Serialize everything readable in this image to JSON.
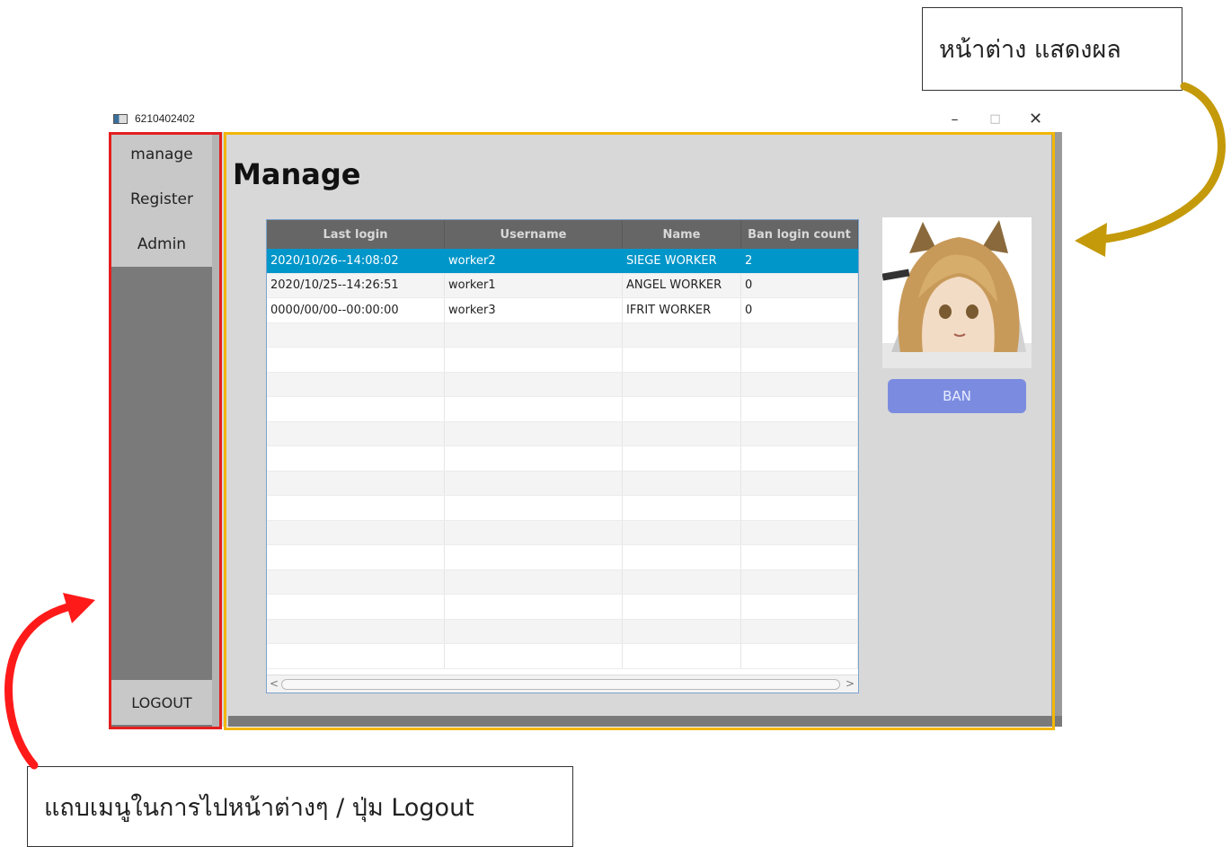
{
  "window": {
    "title": "6210402402",
    "minimize_glyph": "–",
    "maximize_glyph": "□",
    "close_glyph": "✕"
  },
  "sidebar": {
    "items": [
      {
        "label": "manage"
      },
      {
        "label": "Register"
      },
      {
        "label": "Admin"
      }
    ],
    "logout_label": "LOGOUT"
  },
  "main": {
    "title": "Manage",
    "table": {
      "columns": [
        "Last login",
        "Username",
        "Name",
        "Ban login count"
      ],
      "rows": [
        [
          "2020/10/26--14:08:02",
          "worker2",
          "SIEGE WORKER",
          "2"
        ],
        [
          "2020/10/25--14:26:51",
          "worker1",
          "ANGEL WORKER",
          "0"
        ],
        [
          "0000/00/00--00:00:00",
          "worker3",
          "IFRIT WORKER",
          "0"
        ]
      ],
      "selected_row": 0
    },
    "ban_label": "BAN"
  },
  "annotations": {
    "display_window": "หน้าต่าง แสดงผล",
    "menu_bar": "แถบเมนูในการไปหน้าต่างๆ / ปุ่ม Logout"
  },
  "colors": {
    "selection": "#0096c9",
    "ban_button": "#7b8ce0",
    "sidebar_highlight": "#e41f1f",
    "content_highlight": "#f2b705",
    "arrow_gold": "#c49a0a",
    "arrow_red": "#ff1a1a"
  }
}
